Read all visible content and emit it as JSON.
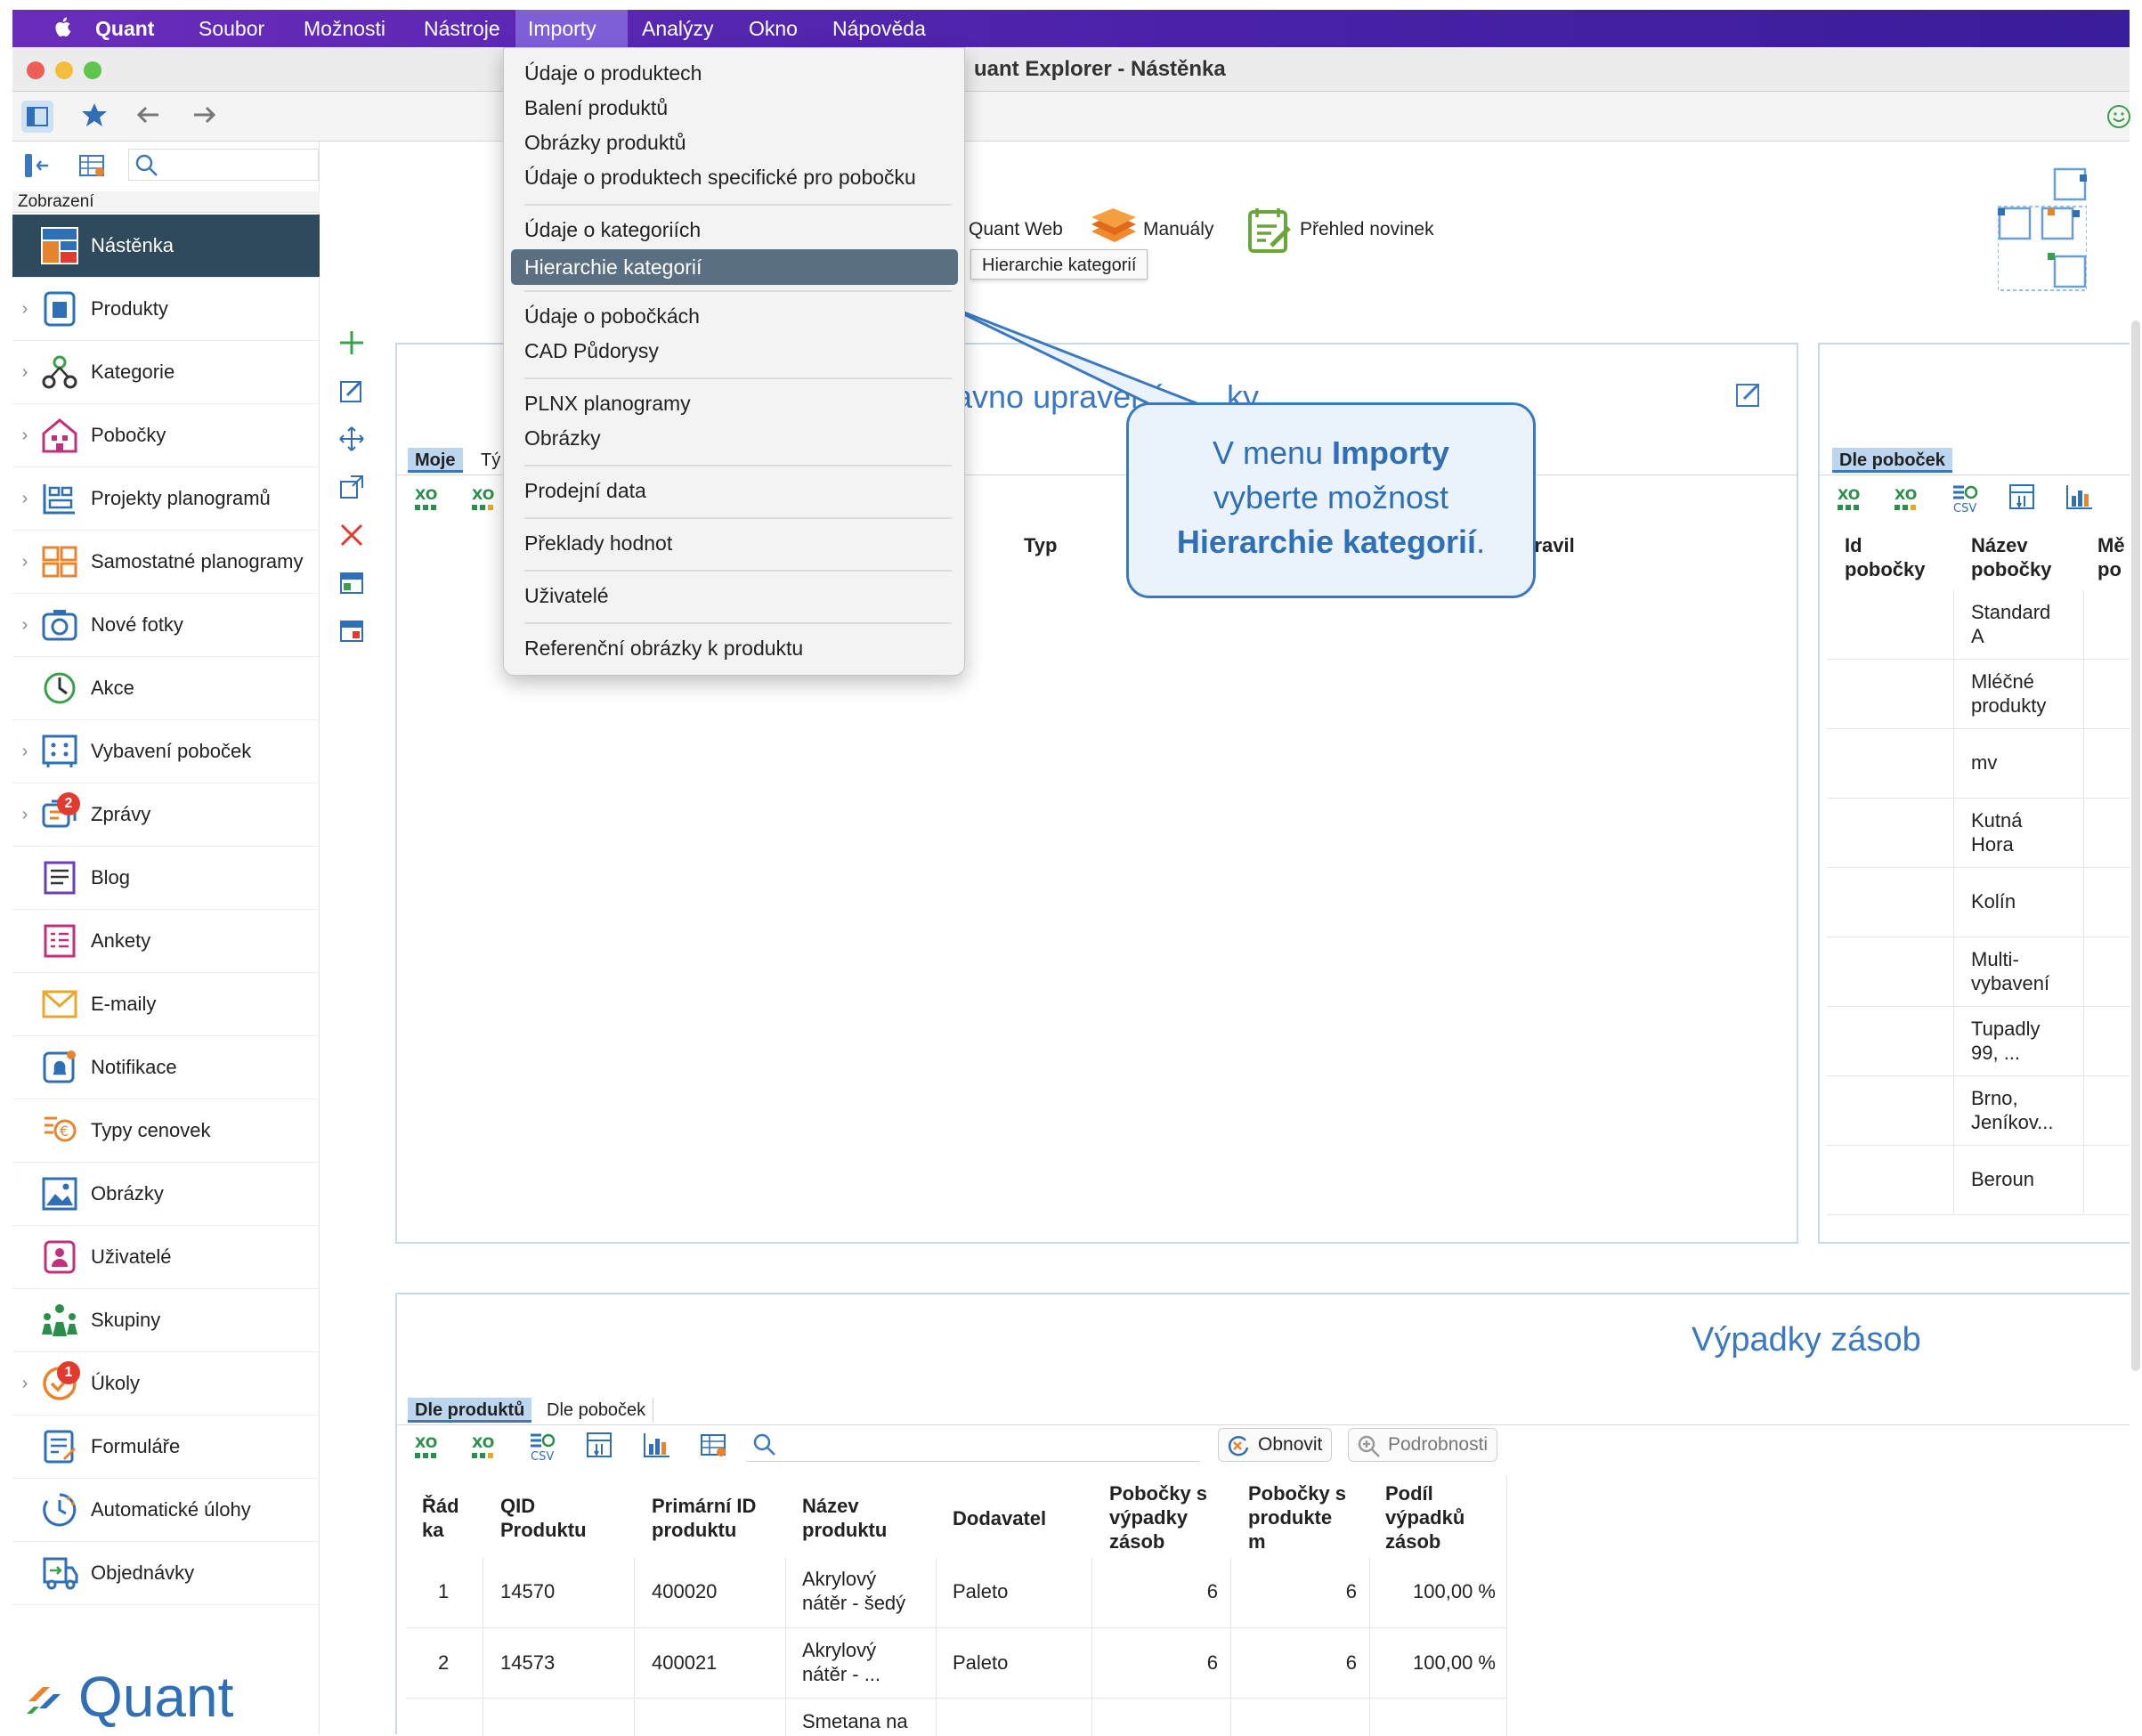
{
  "menubar": {
    "apple": "",
    "app": "Quant",
    "items": [
      "Soubor",
      "Možnosti",
      "Nástroje",
      "Importy",
      "Analýzy",
      "Okno",
      "Nápověda"
    ]
  },
  "window": {
    "title": "uant Explorer - Nástěnka"
  },
  "sidebar": {
    "section_label": "Zobrazení",
    "items": [
      {
        "label": "Nástěnka"
      },
      {
        "label": "Produkty"
      },
      {
        "label": "Kategorie"
      },
      {
        "label": "Pobočky"
      },
      {
        "label": "Projekty planogramů"
      },
      {
        "label": "Samostatné planogramy"
      },
      {
        "label": "Nové fotky"
      },
      {
        "label": "Akce"
      },
      {
        "label": "Vybavení poboček"
      },
      {
        "label": "Zprávy",
        "badge": "2"
      },
      {
        "label": "Blog"
      },
      {
        "label": "Ankety"
      },
      {
        "label": "E-maily"
      },
      {
        "label": "Notifikace"
      },
      {
        "label": "Typy cenovek"
      },
      {
        "label": "Obrázky"
      },
      {
        "label": "Uživatelé"
      },
      {
        "label": "Skupiny"
      },
      {
        "label": "Úkoly",
        "badge": "1"
      },
      {
        "label": "Formuláře"
      },
      {
        "label": "Automatické úlohy"
      },
      {
        "label": "Objednávky"
      }
    ],
    "logo_text": "Quant"
  },
  "dropdown": {
    "items": [
      "Údaje o produktech",
      "Balení produktů",
      "Obrázky produktů",
      "Údaje o produktech specifické pro pobočku",
      "Údaje o kategoriích",
      "Hierarchie kategorií",
      "Údaje o pobočkách",
      "CAD Půdorysy",
      "PLNX planogramy",
      "Obrázky",
      "Prodejní data",
      "Překlady hodnot",
      "Uživatelé",
      "Referenční obrázky k produktu"
    ],
    "highlighted": "Hierarchie kategorií"
  },
  "quicklinks": {
    "quantweb": "Quant Web",
    "manualy": "Manuály",
    "novinky": "Přehled novinek",
    "tooltip": "Hierarchie kategorií"
  },
  "callout": {
    "line1_pre": "V menu ",
    "line1_bold": "Importy",
    "line2": "vyberte možnost",
    "line3_bold": "Hierarchie kategorií",
    "line3_post": "."
  },
  "panel_recent": {
    "title_partial": "avno upravené",
    "title_tail": "ky",
    "tabs": [
      "Moje",
      "Tý"
    ],
    "col_typ": "Typ",
    "col_upravil": "pravil"
  },
  "panel_branches": {
    "tab": "Dle poboček",
    "headers": [
      "Id\npobočky",
      "Název\npobočky",
      "Mě\npo"
    ],
    "names": [
      "Standard\nA",
      "Mléčné\nprodukty",
      "mv",
      "Kutná\nHora",
      "Kolín",
      "Multi-\nvybavení",
      "Tupadly\n99, ...",
      "Brno,\nJeníkov...",
      "Beroun"
    ]
  },
  "panel_outofstock": {
    "title": "Výpadky zásob",
    "tabs": [
      "Dle produktů",
      "Dle poboček"
    ],
    "refresh_label": "Obnovit",
    "details_label": "Podrobnosti",
    "headers": [
      "Řád\nka",
      "QID\nProduktu",
      "Primární ID\nproduktu",
      "Název\nproduktu",
      "Dodavatel",
      "Pobočky s\nvýpadky\nzásob",
      "Pobočky s\nprodukte\nm",
      "Podíl\nvýpadků\nzásob"
    ],
    "rows": [
      [
        "1",
        "14570",
        "400020",
        "Akrylový\nnátěr - šedý",
        "Paleto",
        "6",
        "6",
        "100,00 %"
      ],
      [
        "2",
        "14573",
        "400021",
        "Akrylový\nnátěr - ...",
        "Paleto",
        "6",
        "6",
        "100,00 %"
      ],
      [
        "",
        "",
        "",
        "Smetana na",
        "",
        "",
        "",
        ""
      ]
    ]
  },
  "colors": {
    "menubar": "#4a22a8",
    "selected_sidebar": "#2e4a5c",
    "accent_blue": "#3a78c0",
    "dropdown_highlight": "#5a6f82",
    "badge": "#e23a2f"
  }
}
